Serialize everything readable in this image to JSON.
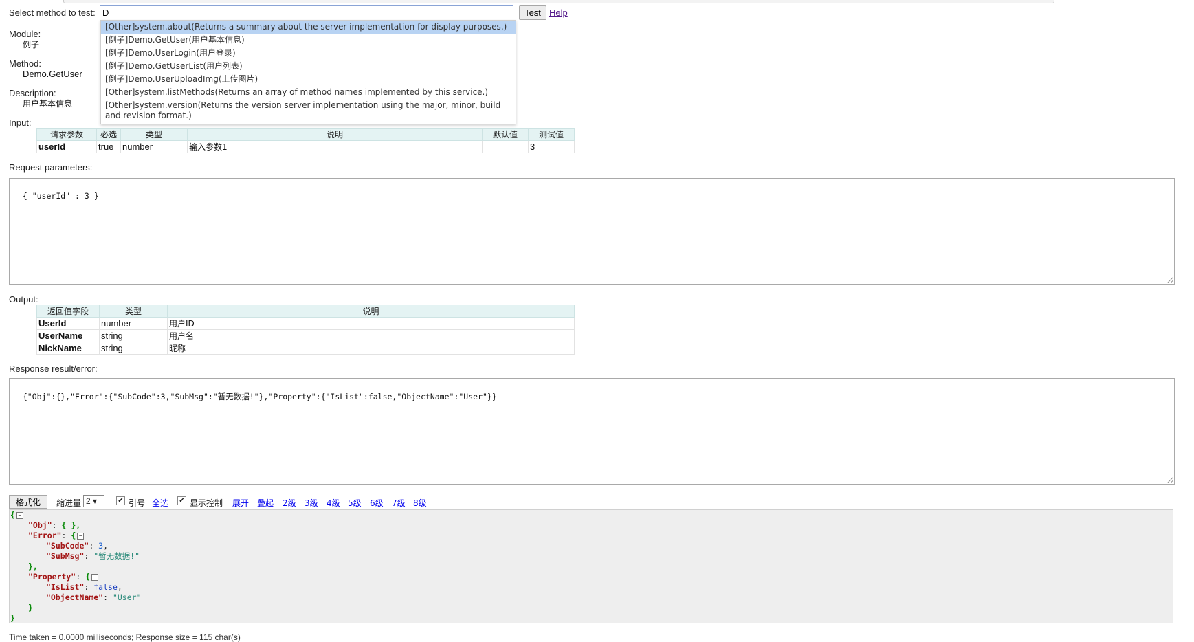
{
  "top": {
    "select_label": "Select method to test:",
    "method_value": "D",
    "test_label": "Test",
    "help_label": "Help"
  },
  "dropdown": {
    "items": [
      "[Other]system.about(Returns a summary about the server implementation for display purposes.)",
      "[例子]Demo.GetUser(用户基本信息)",
      "[例子]Demo.UserLogin(用户登录)",
      "[例子]Demo.GetUserList(用户列表)",
      "[例子]Demo.UserUploadImg(上传图片)",
      "[Other]system.listMethods(Returns an array of method names implemented by this service.)",
      "[Other]system.version(Returns the version server implementation using the major, minor, build and revision format.)"
    ]
  },
  "info": {
    "module_label": "Module:",
    "module_value": "例子",
    "method_label": "Method:",
    "method_value": "Demo.GetUser",
    "description_label": "Description:",
    "description_value": "用户基本信息"
  },
  "input": {
    "label": "Input:",
    "headers": [
      "请求参数",
      "必选",
      "类型",
      "说明",
      "默认值",
      "测试值"
    ],
    "rows": [
      [
        "userId",
        "true",
        "number",
        "输入参数1",
        "",
        "3"
      ]
    ]
  },
  "request": {
    "label": "Request parameters:",
    "text": "{ \"userId\" : 3 }"
  },
  "output": {
    "label": "Output:",
    "headers": [
      "返回值字段",
      "类型",
      "说明"
    ],
    "rows": [
      [
        "UserId",
        "number",
        "用户ID"
      ],
      [
        "UserName",
        "string",
        "用户名"
      ],
      [
        "NickName",
        "string",
        "昵称"
      ]
    ]
  },
  "response": {
    "label": "Response result/error:",
    "text": "{\"Obj\":{},\"Error\":{\"SubCode\":3,\"SubMsg\":\"暂无数据!\"},\"Property\":{\"IsList\":false,\"ObjectName\":\"User\"}}"
  },
  "toolbar": {
    "format_label": "格式化",
    "indent_label": "缩进量",
    "indent_value": "2 ▾",
    "quote_label": "引号",
    "select_all_label": "全选",
    "show_control_label": "显示控制",
    "expand_label": "展开",
    "collapse_label": "叠起",
    "levels": [
      "2级",
      "3级",
      "4级",
      "5级",
      "6级",
      "7级",
      "8级"
    ]
  },
  "json_view": {
    "obj_key": "\"Obj\"",
    "error_key": "\"Error\"",
    "subcode_key": "\"SubCode\"",
    "subcode_val": "3",
    "submsg_key": "\"SubMsg\"",
    "submsg_val": "\"暂无数据!\"",
    "property_key": "\"Property\"",
    "islist_key": "\"IsList\"",
    "islist_val": "false",
    "objectname_key": "\"ObjectName\"",
    "objectname_val": "\"User\""
  },
  "footer": {
    "text": "Time taken = 0.0000 milliseconds; Response size = 115 char(s)"
  },
  "icons": {
    "toggle": "collapse-toggle-icon",
    "checkbox": "checkbox-checked-icon",
    "grip": "resize-grip-icon"
  }
}
